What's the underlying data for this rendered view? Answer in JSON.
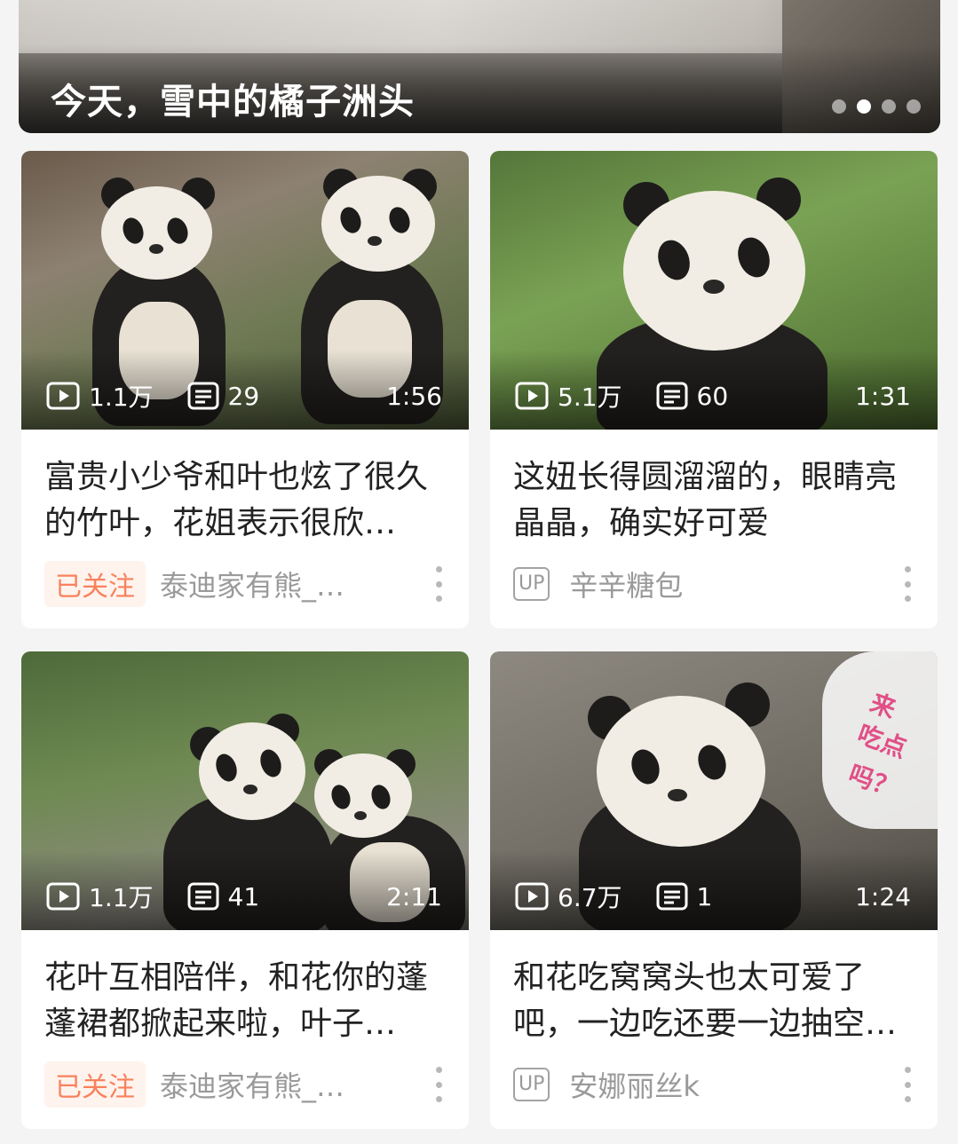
{
  "banner": {
    "title": "今天，雪中的橘子洲头",
    "dots": 4,
    "active_dot": 2
  },
  "cards": [
    {
      "views": "1.1万",
      "comments": "29",
      "duration": "1:56",
      "title": "富贵小少爷和叶也炫了很久的竹叶，花姐表示很欣…",
      "badge": "已关注",
      "author": "泰迪家有熊_…"
    },
    {
      "views": "5.1万",
      "comments": "60",
      "duration": "1:31",
      "title": "这妞长得圆溜溜的，眼睛亮晶晶，确实好可爱",
      "badge": "UP",
      "author": "辛辛糖包"
    },
    {
      "views": "1.1万",
      "comments": "41",
      "duration": "2:11",
      "title": "花叶互相陪伴，和花你的蓬蓬裙都掀起来啦，叶子…",
      "badge": "已关注",
      "author": "泰迪家有熊_…"
    },
    {
      "views": "6.7万",
      "comments": "1",
      "duration": "1:24",
      "title": "和花吃窝窝头也太可爱了吧，一边吃还要一边抽空…",
      "badge": "UP",
      "author": "安娜丽丝k",
      "sticker": [
        "来",
        "吃点",
        "吗？"
      ]
    }
  ],
  "colors": {
    "followed_text": "#f8825c",
    "followed_bg": "#fff3ee",
    "meta_gray": "#9a9a9a"
  },
  "icons": [
    "play-count-icon",
    "danmaku-icon",
    "more-vertical-icon",
    "up-badge-icon"
  ]
}
